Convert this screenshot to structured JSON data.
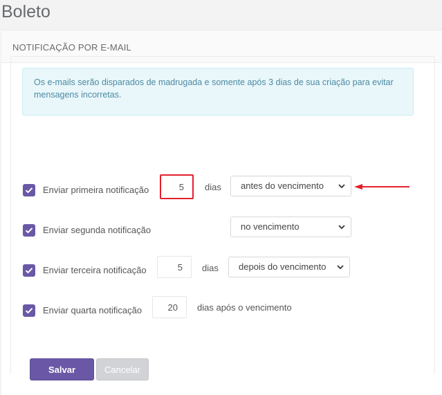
{
  "page": {
    "title": "Boleto"
  },
  "panel": {
    "header": "NOTIFICAÇÃO POR E-MAIL"
  },
  "alert": {
    "text": "Os e-mails serão disparados de madrugada e somente após 3 dias de sua criação para evitar mensagens incorretas."
  },
  "notifications": [
    {
      "label": "Enviar primeira notificação",
      "checked": true,
      "days": "5",
      "unit": "dias",
      "when": "antes do vencimento",
      "highlighted": true
    },
    {
      "label": "Enviar segunda notificação",
      "checked": true,
      "when": "no vencimento"
    },
    {
      "label": "Enviar terceira notificação",
      "checked": true,
      "days": "5",
      "unit": "dias",
      "when": "depois do vencimento"
    },
    {
      "label": "Enviar quarta notificação",
      "checked": true,
      "days": "20",
      "unit": "dias após o vencimento"
    }
  ],
  "actions": {
    "save": "Salvar",
    "cancel": "Cancelar"
  },
  "annotation": {
    "icon": "red-arrow-left-icon",
    "color": "#e3202c"
  },
  "colors": {
    "accent": "#6a58a6",
    "alert_bg": "#e9f7fb",
    "highlight": "#e3202c"
  }
}
